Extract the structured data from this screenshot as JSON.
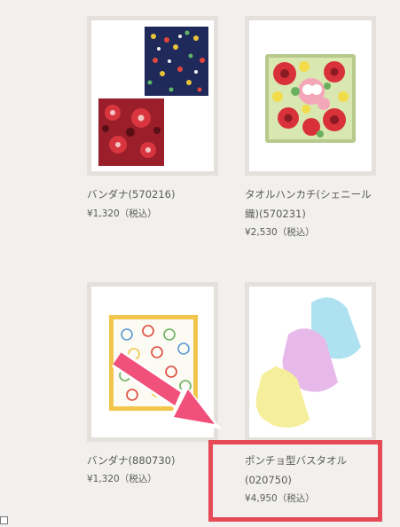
{
  "products": [
    {
      "name": "バンダナ(570216)",
      "price": "¥1,320（税込）"
    },
    {
      "name": "タオルハンカチ(シェニール織)(570231)",
      "price": "¥2,530（税込）"
    },
    {
      "name": "バンダナ(880730)",
      "price": "¥1,320（税込）"
    },
    {
      "name": "ポンチョ型バスタオル(020750)",
      "price": "¥4,950（税込）"
    }
  ],
  "annotation": {
    "arrow_color": "#f0507a",
    "box_color": "#e64a57"
  }
}
